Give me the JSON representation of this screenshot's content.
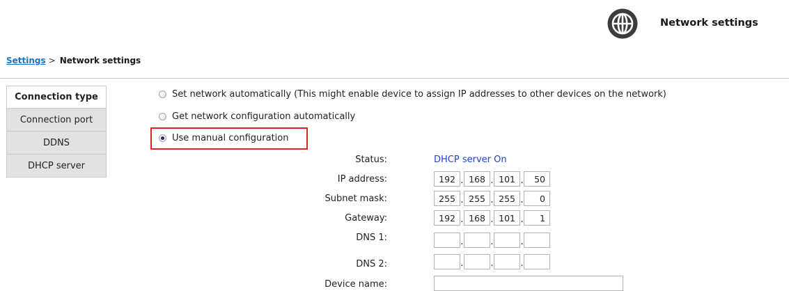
{
  "header": {
    "title": "Network settings",
    "icon": "globe-icon"
  },
  "breadcrumb": {
    "parent": "Settings",
    "separator": ">",
    "current": "Network settings"
  },
  "tabs": [
    {
      "label": "Connection type",
      "active": true
    },
    {
      "label": "Connection port",
      "active": false
    },
    {
      "label": "DDNS",
      "active": false
    },
    {
      "label": "DHCP server",
      "active": false
    }
  ],
  "options": [
    {
      "label": "Set network automatically (This might enable device to assign IP addresses to other devices on the network)",
      "checked": false
    },
    {
      "label": "Get network configuration automatically",
      "checked": false
    },
    {
      "label": "Use manual configuration",
      "checked": true
    }
  ],
  "form": {
    "status": {
      "label": "Status:",
      "value": "DHCP server On"
    },
    "ip_address": {
      "label": "IP address:",
      "octets": [
        "192",
        "168",
        "101",
        "50"
      ]
    },
    "subnet_mask": {
      "label": "Subnet mask:",
      "octets": [
        "255",
        "255",
        "255",
        "0"
      ]
    },
    "gateway": {
      "label": "Gateway:",
      "octets": [
        "192",
        "168",
        "101",
        "1"
      ]
    },
    "dns1": {
      "label": "DNS 1:",
      "octets": [
        "",
        "",
        "",
        ""
      ]
    },
    "dns2": {
      "label": "DNS 2:",
      "octets": [
        "",
        "",
        "",
        ""
      ]
    },
    "device_name": {
      "label": "Device name:",
      "value": ""
    },
    "octet_separator": "."
  },
  "colors": {
    "link": "#1a73c6",
    "status": "#2040d0",
    "highlight": "#e01f26",
    "tab_bg": "#e2e2e2"
  }
}
